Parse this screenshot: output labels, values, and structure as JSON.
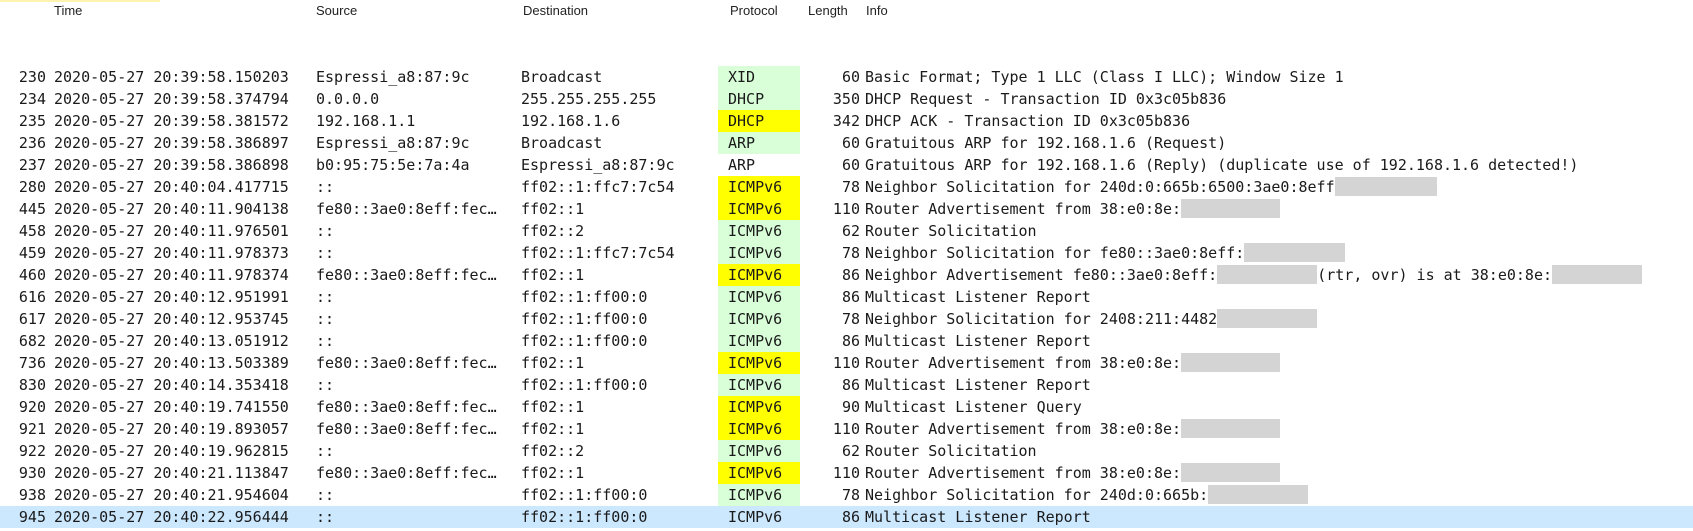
{
  "headers": {
    "time": "Time",
    "source": "Source",
    "destination": "Destination",
    "protocol": "Protocol",
    "length": "Length",
    "info": "Info"
  },
  "colors": {
    "udp_green": "#d9ffd9",
    "highlight_yellow": "#ffff00",
    "selected": "#cce8ff",
    "redaction": "#d4d4d4"
  },
  "packets": [
    {
      "no": "230",
      "time": "2020-05-27 20:39:58.150203",
      "source": "Espressi_a8:87:9c",
      "destination": "Broadcast",
      "protocol": "XID",
      "proto_bg": "#d9ffd9",
      "length": "60",
      "info": "Basic Format; Type 1 LLC (Class I LLC); Window Size 1",
      "info_after": "",
      "redact1": 0,
      "redact2": 0
    },
    {
      "no": "234",
      "time": "2020-05-27 20:39:58.374794",
      "source": "0.0.0.0",
      "destination": "255.255.255.255",
      "protocol": "DHCP",
      "proto_bg": "#d9ffd9",
      "length": "350",
      "info": "DHCP Request  - Transaction ID 0x3c05b836",
      "info_after": "",
      "redact1": 0,
      "redact2": 0
    },
    {
      "no": "235",
      "time": "2020-05-27 20:39:58.381572",
      "source": "192.168.1.1",
      "destination": "192.168.1.6",
      "protocol": "DHCP",
      "proto_bg": "#ffff00",
      "length": "342",
      "info": "DHCP ACK      - Transaction ID 0x3c05b836",
      "info_after": "",
      "redact1": 0,
      "redact2": 0
    },
    {
      "no": "236",
      "time": "2020-05-27 20:39:58.386897",
      "source": "Espressi_a8:87:9c",
      "destination": "Broadcast",
      "protocol": "ARP",
      "proto_bg": "#d9ffd9",
      "length": "60",
      "info": "Gratuitous ARP for 192.168.1.6 (Request)",
      "info_after": "",
      "redact1": 0,
      "redact2": 0
    },
    {
      "no": "237",
      "time": "2020-05-27 20:39:58.386898",
      "source": "b0:95:75:5e:7a:4a",
      "destination": "Espressi_a8:87:9c",
      "protocol": "ARP",
      "proto_bg": "",
      "length": "60",
      "info": "Gratuitous ARP for 192.168.1.6 (Reply) (duplicate use of 192.168.1.6 detected!)",
      "info_after": "",
      "redact1": 0,
      "redact2": 0
    },
    {
      "no": "280",
      "time": "2020-05-27 20:40:04.417715",
      "source": "::",
      "destination": "ff02::1:ffc7:7c54",
      "protocol": "ICMPv6",
      "proto_bg": "#ffff00",
      "length": "78",
      "info": "Neighbor Solicitation for 240d:0:665b:6500:3ae0:8eff",
      "info_after": "",
      "redact1": 102,
      "redact2": 0
    },
    {
      "no": "445",
      "time": "2020-05-27 20:40:11.904138",
      "source": "fe80::3ae0:8eff:fec…",
      "destination": "ff02::1",
      "protocol": "ICMPv6",
      "proto_bg": "#ffff00",
      "length": "110",
      "info": "Router Advertisement from 38:e0:8e:",
      "info_after": "",
      "redact1": 99,
      "redact2": 0
    },
    {
      "no": "458",
      "time": "2020-05-27 20:40:11.976501",
      "source": "::",
      "destination": "ff02::2",
      "protocol": "ICMPv6",
      "proto_bg": "#d9ffd9",
      "length": "62",
      "info": "Router Solicitation",
      "info_after": "",
      "redact1": 0,
      "redact2": 0
    },
    {
      "no": "459",
      "time": "2020-05-27 20:40:11.978373",
      "source": "::",
      "destination": "ff02::1:ffc7:7c54",
      "protocol": "ICMPv6",
      "proto_bg": "#d9ffd9",
      "length": "78",
      "info": "Neighbor Solicitation for fe80::3ae0:8eff:",
      "info_after": "",
      "redact1": 101,
      "redact2": 0
    },
    {
      "no": "460",
      "time": "2020-05-27 20:40:11.978374",
      "source": "fe80::3ae0:8eff:fec…",
      "destination": "ff02::1",
      "protocol": "ICMPv6",
      "proto_bg": "#ffff00",
      "length": "86",
      "info": "Neighbor Advertisement fe80::3ae0:8eff:",
      "info_after": "(rtr, ovr) is at 38:e0:8e:",
      "redact1": 100,
      "redact2": 90
    },
    {
      "no": "616",
      "time": "2020-05-27 20:40:12.951991",
      "source": "::",
      "destination": "ff02::1:ff00:0",
      "protocol": "ICMPv6",
      "proto_bg": "#d9ffd9",
      "length": "86",
      "info": "Multicast Listener Report",
      "info_after": "",
      "redact1": 0,
      "redact2": 0
    },
    {
      "no": "617",
      "time": "2020-05-27 20:40:12.953745",
      "source": "::",
      "destination": "ff02::1:ff00:0",
      "protocol": "ICMPv6",
      "proto_bg": "#d9ffd9",
      "length": "78",
      "info": "Neighbor Solicitation for 2408:211:4482",
      "info_after": "",
      "redact1": 100,
      "redact2": 0
    },
    {
      "no": "682",
      "time": "2020-05-27 20:40:13.051912",
      "source": "::",
      "destination": "ff02::1:ff00:0",
      "protocol": "ICMPv6",
      "proto_bg": "#d9ffd9",
      "length": "86",
      "info": "Multicast Listener Report",
      "info_after": "",
      "redact1": 0,
      "redact2": 0
    },
    {
      "no": "736",
      "time": "2020-05-27 20:40:13.503389",
      "source": "fe80::3ae0:8eff:fec…",
      "destination": "ff02::1",
      "protocol": "ICMPv6",
      "proto_bg": "#ffff00",
      "length": "110",
      "info": "Router Advertisement from 38:e0:8e:",
      "info_after": "",
      "redact1": 99,
      "redact2": 0
    },
    {
      "no": "830",
      "time": "2020-05-27 20:40:14.353418",
      "source": "::",
      "destination": "ff02::1:ff00:0",
      "protocol": "ICMPv6",
      "proto_bg": "#d9ffd9",
      "length": "86",
      "info": "Multicast Listener Report",
      "info_after": "",
      "redact1": 0,
      "redact2": 0
    },
    {
      "no": "920",
      "time": "2020-05-27 20:40:19.741550",
      "source": "fe80::3ae0:8eff:fec…",
      "destination": "ff02::1",
      "protocol": "ICMPv6",
      "proto_bg": "#ffff00",
      "length": "90",
      "info": "Multicast Listener Query",
      "info_after": "",
      "redact1": 0,
      "redact2": 0
    },
    {
      "no": "921",
      "time": "2020-05-27 20:40:19.893057",
      "source": "fe80::3ae0:8eff:fec…",
      "destination": "ff02::1",
      "protocol": "ICMPv6",
      "proto_bg": "#ffff00",
      "length": "110",
      "info": "Router Advertisement from 38:e0:8e:",
      "info_after": "",
      "redact1": 99,
      "redact2": 0
    },
    {
      "no": "922",
      "time": "2020-05-27 20:40:19.962815",
      "source": "::",
      "destination": "ff02::2",
      "protocol": "ICMPv6",
      "proto_bg": "#d9ffd9",
      "length": "62",
      "info": "Router Solicitation",
      "info_after": "",
      "redact1": 0,
      "redact2": 0
    },
    {
      "no": "930",
      "time": "2020-05-27 20:40:21.113847",
      "source": "fe80::3ae0:8eff:fec…",
      "destination": "ff02::1",
      "protocol": "ICMPv6",
      "proto_bg": "#ffff00",
      "length": "110",
      "info": "Router Advertisement from 38:e0:8e:",
      "info_after": "",
      "redact1": 99,
      "redact2": 0
    },
    {
      "no": "938",
      "time": "2020-05-27 20:40:21.954604",
      "source": "::",
      "destination": "ff02::1:ff00:0",
      "protocol": "ICMPv6",
      "proto_bg": "#d9ffd9",
      "length": "78",
      "info": "Neighbor Solicitation for 240d:0:665b:",
      "info_after": "",
      "redact1": 100,
      "redact2": 0
    },
    {
      "no": "945",
      "time": "2020-05-27 20:40:22.956444",
      "source": "::",
      "destination": "ff02::1:ff00:0",
      "protocol": "ICMPv6",
      "proto_bg": "",
      "length": "86",
      "info": "Multicast Listener Report",
      "info_after": "",
      "redact1": 0,
      "redact2": 0,
      "selected": true
    }
  ]
}
